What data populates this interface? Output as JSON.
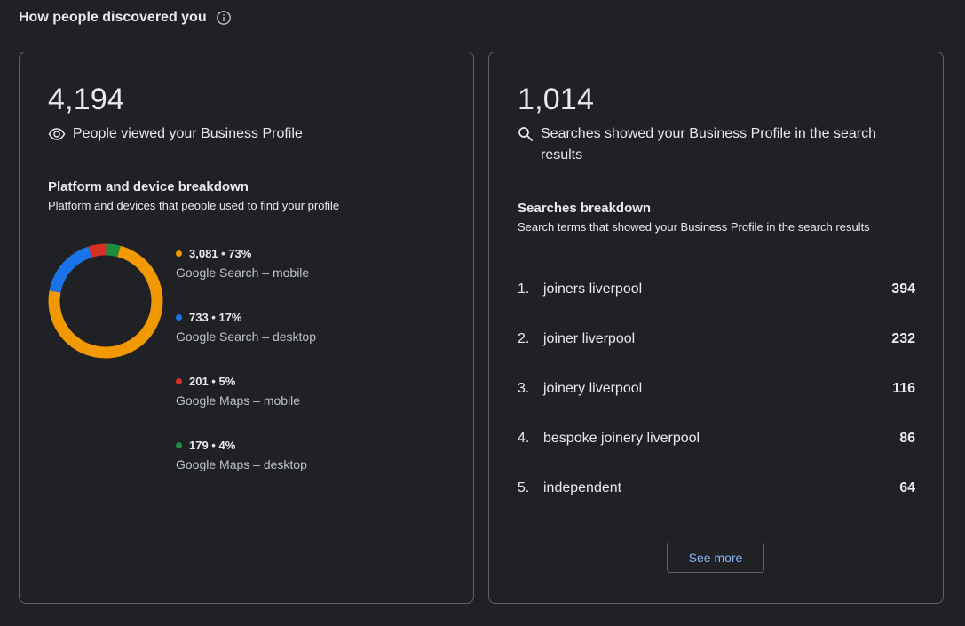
{
  "header": {
    "title": "How people discovered you",
    "info_icon": "info-icon"
  },
  "views_card": {
    "value": "4,194",
    "label": "People viewed your Business Profile",
    "icon": "eye-icon",
    "breakdown_title": "Platform and device breakdown",
    "breakdown_subtitle": "Platform and devices that people used to find your profile",
    "segments": [
      {
        "value_label": "3,081 • 73%",
        "name": "Google Search – mobile",
        "color": "#f29900",
        "percent": 73
      },
      {
        "value_label": "733 • 17%",
        "name": "Google Search – desktop",
        "color": "#1a73e8",
        "percent": 17
      },
      {
        "value_label": "201 • 5%",
        "name": "Google Maps – mobile",
        "color": "#d93025",
        "percent": 5
      },
      {
        "value_label": "179 • 4%",
        "name": "Google Maps – desktop",
        "color": "#1e8e3e",
        "percent": 4
      }
    ]
  },
  "searches_card": {
    "value": "1,014",
    "label": "Searches showed your Business Profile in the search results",
    "icon": "search-icon",
    "breakdown_title": "Searches breakdown",
    "breakdown_subtitle": "Search terms that showed your Business Profile in the search results",
    "terms": [
      {
        "rank": "1.",
        "term": "joiners liverpool",
        "count": "394"
      },
      {
        "rank": "2.",
        "term": "joiner liverpool",
        "count": "232"
      },
      {
        "rank": "3.",
        "term": "joinery liverpool",
        "count": "116"
      },
      {
        "rank": "4.",
        "term": "bespoke joinery liverpool",
        "count": "86"
      },
      {
        "rank": "5.",
        "term": "independent",
        "count": "64"
      }
    ],
    "see_more_label": "See more"
  }
}
